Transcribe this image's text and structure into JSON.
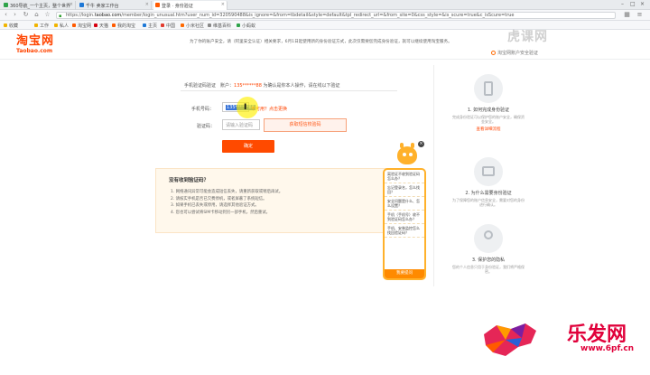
{
  "browser": {
    "tabs": [
      {
        "label": "360导航_一个主页，整个世界",
        "fav_color": "#2ea34a"
      },
      {
        "label": "千牛 卖家工作台",
        "fav_color": "#1e78d6"
      },
      {
        "label": "登录 · 身份验证",
        "fav_color": "#ff5a00"
      }
    ],
    "url_prefix": "https://login.",
    "url_domain": "taobao.com",
    "url_rest": "/member/login_unusual.htm?user_num_id=320590488&is_ignore=&from=tbdetail&style=default&tpl_redirect_url=&from_site=0&css_style=&is_scure=true&c_isScure=true"
  },
  "bookmarks": [
    {
      "label": "收藏",
      "color": "#f0b400"
    },
    {
      "label": "工作",
      "color": "#f0b400"
    },
    {
      "label": "私人",
      "color": "#f0b400"
    },
    {
      "label": "淘宝网",
      "color": "#ff5a00"
    },
    {
      "label": "天猫",
      "color": "#d6000f"
    },
    {
      "label": "我的淘宝",
      "color": "#ff5a00"
    },
    {
      "label": "主页",
      "color": "#1e78d6"
    },
    {
      "label": "中国",
      "color": "#e23c2f"
    },
    {
      "label": "小米社区",
      "color": "#ff6900"
    },
    {
      "label": "维基百科",
      "color": "#888888"
    },
    {
      "label": "小蚂蚁",
      "color": "#2ea34a"
    }
  ],
  "header": {
    "logo_cn": "淘宝网",
    "logo_en": "Taobao.com",
    "notice": "为了你的账户安全，请（阿里安全认证）相关要求，6月1日起使用新的身份验证方式，此次仅需要您完成身份验证，就可以继续使用淘宝服务。",
    "notice_link": "淘宝网账户安全验证"
  },
  "form": {
    "phone_label": "手机验证码验证",
    "phone_prefix": "账户：",
    "phone_number": "135******88",
    "phone_suffix": " 为确认是你本人操作，请在线以下验证",
    "mobile_label": "手机号码：",
    "mobile_value": "135******88",
    "mobile_hint": "不可用？点击更换",
    "code_label": "验证码：",
    "code_placeholder": "请输入验证码",
    "send_button": "获取短信校验码",
    "confirm_button": "确定"
  },
  "tips": {
    "title": "没有收到验证码？",
    "items": [
      "1. 网络通讯异常可能会造成短信丢失，请重新获取或稍后再试。",
      "2. 请核实手机是否已欠费停机，或者屏蔽了系统短信。",
      "3. 如果手机已丢失或停用，请选择其他验证方式。",
      "4. 您也可以尝试将SIM卡移动到另一部手机，然后重试。"
    ]
  },
  "sidebar": {
    "items": [
      {
        "title": "1. 如何完成身份验证",
        "desc": "完成身份验证可以保护您的账户安全，确保资金安全。",
        "link": "查看详细流程"
      },
      {
        "title": "2. 为什么需要身份验证",
        "desc": "为了保障您的账户信息安全，需要对您的身份进行确认。",
        "link": ""
      },
      {
        "title": "3. 保护您的隐私",
        "desc": "您的个人信息只用于身份验证，我们将严格保密。",
        "link": ""
      }
    ]
  },
  "assistant": {
    "questions": [
      "离验证不收到验证码怎么办？",
      "忘记登录名，怎么找回？",
      "安全问题是什么、怎么设置？",
      "手机（手机号）收不到验证码怎么办？",
      "手机、安装监控怎么找回验证码？"
    ],
    "button": "我要提问",
    "close": "×"
  },
  "watermarks": {
    "top": "虎课网",
    "bottom": "乐发网",
    "bottom_url": "www.6pf.cn"
  }
}
